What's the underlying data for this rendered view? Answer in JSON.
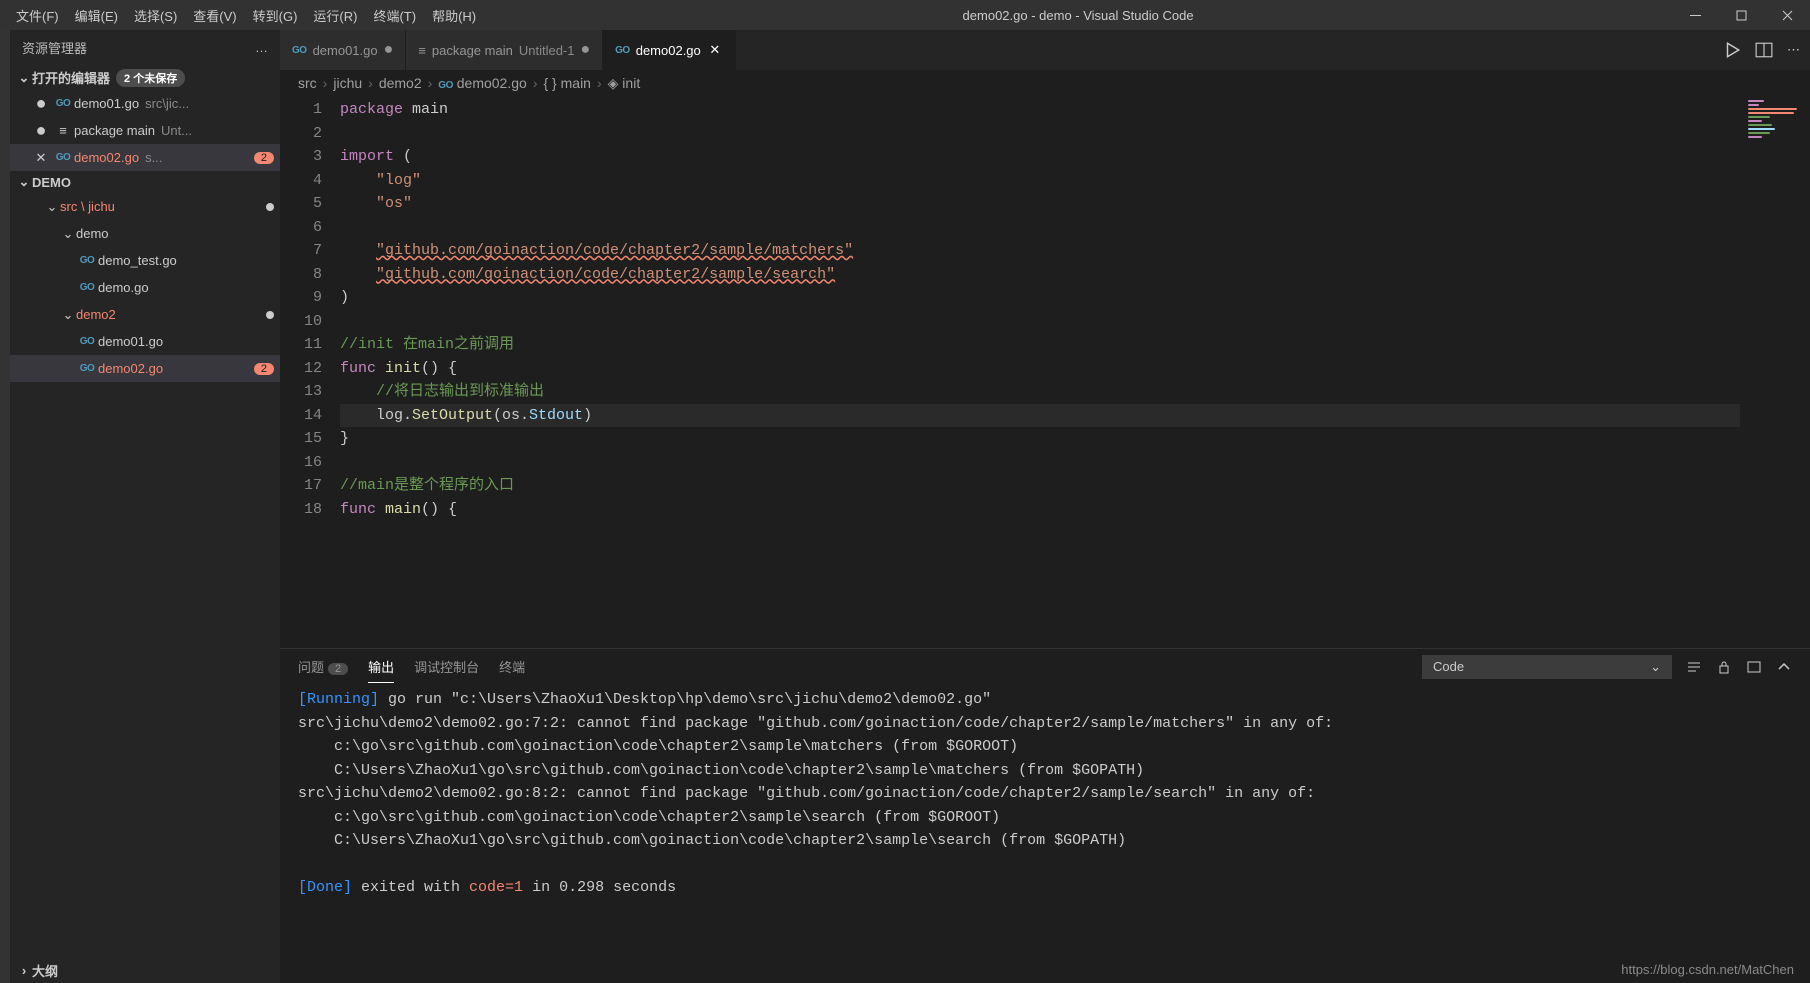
{
  "menubar": [
    "文件(F)",
    "编辑(E)",
    "选择(S)",
    "查看(V)",
    "转到(G)",
    "运行(R)",
    "终端(T)",
    "帮助(H)"
  ],
  "window_title": "demo02.go - demo - Visual Studio Code",
  "sidebar": {
    "title": "资源管理器",
    "more": "…",
    "open_editors_label": "打开的编辑器",
    "open_editors_badge": "2 个未保存",
    "open_editors": [
      {
        "icon": "go",
        "label": "demo01.go",
        "desc": "src\\jic...",
        "dirty": true,
        "error": false
      },
      {
        "icon": "file",
        "label": "package main",
        "desc": "Unt...",
        "dirty": true,
        "error": false
      },
      {
        "icon": "go",
        "label": "demo02.go",
        "desc": "s...",
        "active": true,
        "error": true,
        "count": "2"
      }
    ],
    "workspace_label": "DEMO",
    "tree": [
      {
        "type": "folder",
        "label": "src \\ jichu",
        "indent": 1,
        "error": true,
        "modified": true
      },
      {
        "type": "folder",
        "label": "demo",
        "indent": 2
      },
      {
        "type": "go",
        "label": "demo_test.go",
        "indent": 3
      },
      {
        "type": "go",
        "label": "demo.go",
        "indent": 3
      },
      {
        "type": "folder",
        "label": "demo2",
        "indent": 2,
        "error": true,
        "modified": true
      },
      {
        "type": "go",
        "label": "demo01.go",
        "indent": 3
      },
      {
        "type": "go",
        "label": "demo02.go",
        "indent": 3,
        "error": true,
        "count": "2",
        "active": true
      }
    ],
    "outline_label": "大纲"
  },
  "tabs": [
    {
      "icon": "go",
      "label": "demo01.go",
      "dirty": true
    },
    {
      "icon": "file",
      "label": "package main",
      "desc": "Untitled-1",
      "dirty": true
    },
    {
      "icon": "go",
      "label": "demo02.go",
      "active": true,
      "close": true
    }
  ],
  "breadcrumbs": [
    "src",
    "jichu",
    "demo2",
    "demo02.go",
    "main",
    "init"
  ],
  "code": {
    "lines": [
      {
        "n": 1,
        "html": "<span class='kw'>package</span> main"
      },
      {
        "n": 2,
        "html": ""
      },
      {
        "n": 3,
        "html": "<span class='kw'>import</span> ("
      },
      {
        "n": 4,
        "html": "    <span class='str'>\"log\"</span>"
      },
      {
        "n": 5,
        "html": "    <span class='str'>\"os\"</span>"
      },
      {
        "n": 6,
        "html": ""
      },
      {
        "n": 7,
        "html": "    <span class='str err'>\"github.com/goinaction/code/chapter2/sample/matchers\"</span>"
      },
      {
        "n": 8,
        "html": "    <span class='str err'>\"github.com/goinaction/code/chapter2/sample/search\"</span>"
      },
      {
        "n": 9,
        "html": ")"
      },
      {
        "n": 10,
        "html": ""
      },
      {
        "n": 11,
        "html": "<span class='cm'>//init 在main之前调用</span>"
      },
      {
        "n": 12,
        "html": "<span class='kw'>func</span> <span class='fn'>init</span>() {"
      },
      {
        "n": 13,
        "html": "    <span class='cm'>//将日志输出到标准输出</span>"
      },
      {
        "n": 14,
        "html": "    log.<span class='fn'>SetOutput</span>(os.<span class='id'>Stdout</span>)",
        "hl": true
      },
      {
        "n": 15,
        "html": "}"
      },
      {
        "n": 16,
        "html": ""
      },
      {
        "n": 17,
        "html": "<span class='cm'>//main是整个程序的入口</span>"
      },
      {
        "n": 18,
        "html": "<span class='kw'>func</span> <span class='fn'>main</span>() {"
      }
    ]
  },
  "panel": {
    "tabs": [
      {
        "label": "问题",
        "badge": "2"
      },
      {
        "label": "输出",
        "active": true
      },
      {
        "label": "调试控制台"
      },
      {
        "label": "终端"
      }
    ],
    "select": "Code",
    "output_running": "[Running]",
    "output_cmd": " go run \"c:\\Users\\ZhaoXu1\\Desktop\\hp\\demo\\src\\jichu\\demo2\\demo02.go\"",
    "output_body": "src\\jichu\\demo2\\demo02.go:7:2: cannot find package \"github.com/goinaction/code/chapter2/sample/matchers\" in any of:\n    c:\\go\\src\\github.com\\goinaction\\code\\chapter2\\sample\\matchers (from $GOROOT)\n    C:\\Users\\ZhaoXu1\\go\\src\\github.com\\goinaction\\code\\chapter2\\sample\\matchers (from $GOPATH)\nsrc\\jichu\\demo2\\demo02.go:8:2: cannot find package \"github.com/goinaction/code/chapter2/sample/search\" in any of:\n    c:\\go\\src\\github.com\\goinaction\\code\\chapter2\\sample\\search (from $GOROOT)\n    C:\\Users\\ZhaoXu1\\go\\src\\github.com\\goinaction\\code\\chapter2\\sample\\search (from $GOPATH)",
    "output_done": "[Done]",
    "output_done_tail1": " exited with ",
    "output_done_code": "code=1",
    "output_done_tail2": " in 0.298 seconds"
  },
  "watermark": "https://blog.csdn.net/MatChen"
}
